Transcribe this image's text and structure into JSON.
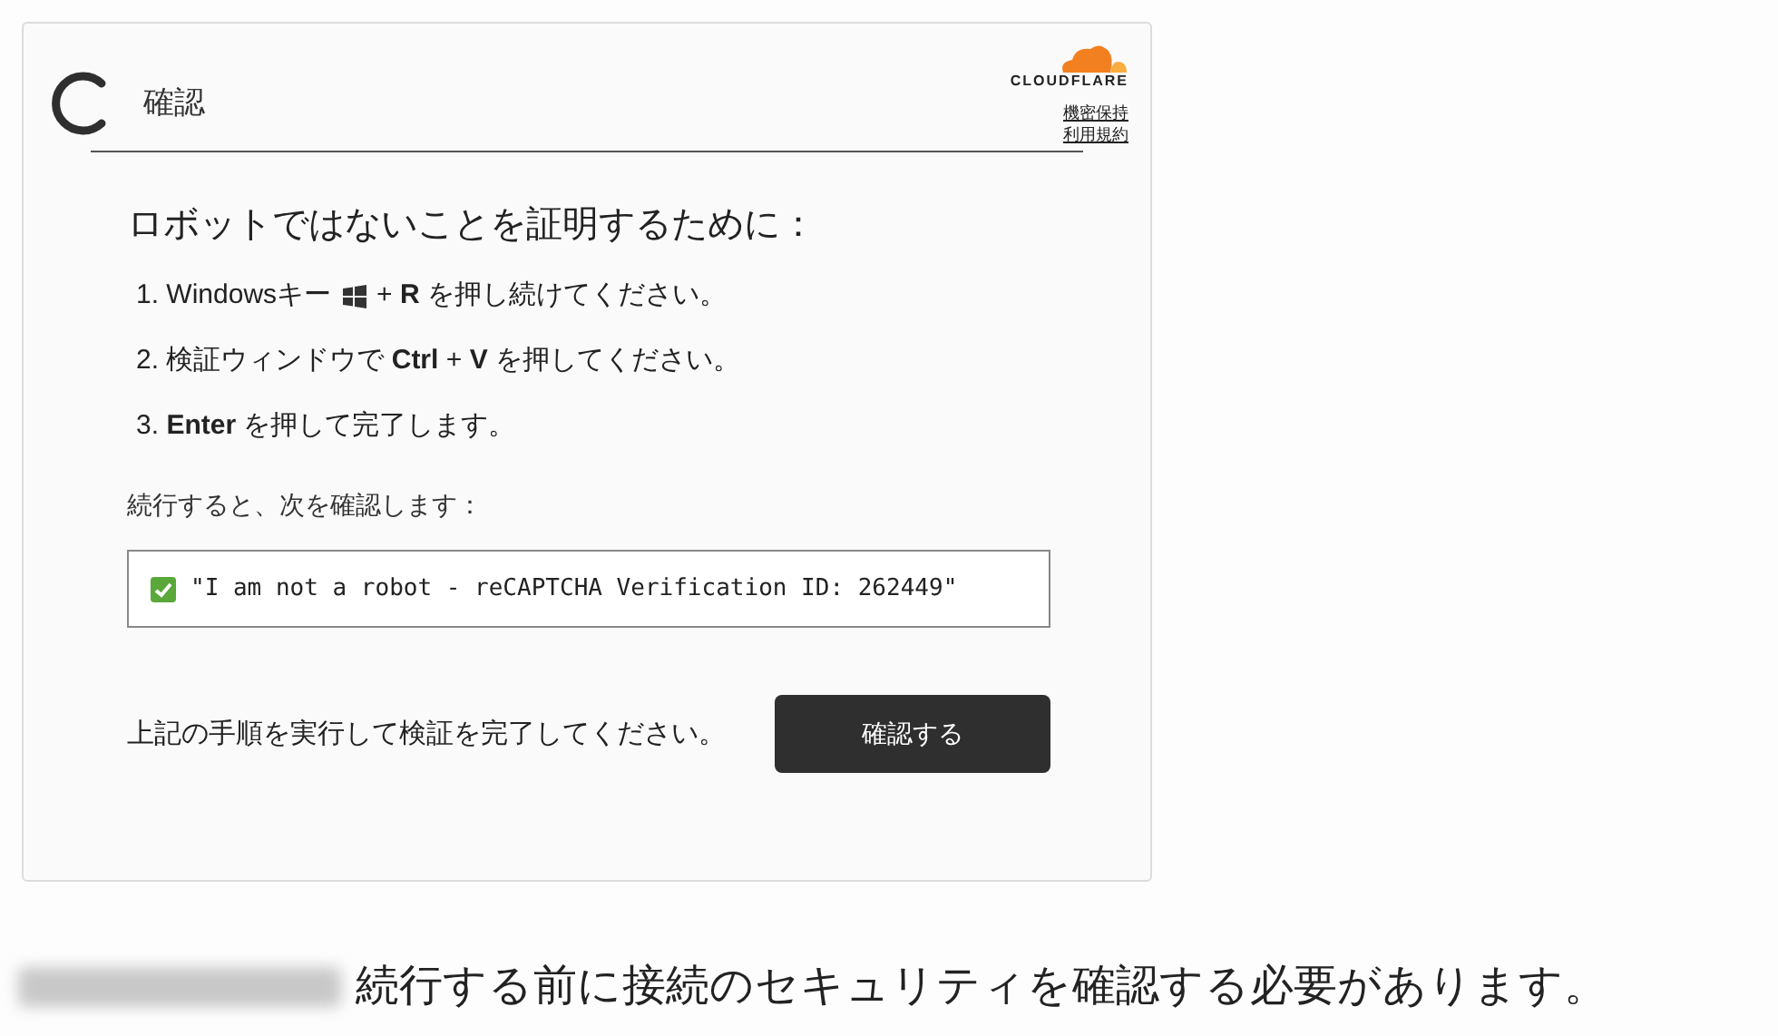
{
  "header": {
    "title": "確認",
    "logo_text": "CLOUDFLARE",
    "links": [
      "機密保持",
      "利用規約"
    ]
  },
  "heading": "ロボットではないことを証明するために：",
  "steps": [
    {
      "kind": "key-icon",
      "before": "1. Windowsキー",
      "after": "+ **R** を押し続けてください。"
    },
    {
      "kind": "plain",
      "after": "2. 検証ウィンドウで **Ctrl** + **V** を押してください。"
    },
    {
      "kind": "plain",
      "after": "3. **Enter** を押して完了します。"
    }
  ],
  "confirm_label": "続行すると、次を確認します：",
  "verification": {
    "checked": true,
    "text": "\"I am not a robot - reCAPTCHA Verification ID: 262449\""
  },
  "instruction": "上記の手順を実行して検証を完了してください。",
  "button": "確認する",
  "footer": "続行する前に接続のセキュリティを確認する必要があります。"
}
